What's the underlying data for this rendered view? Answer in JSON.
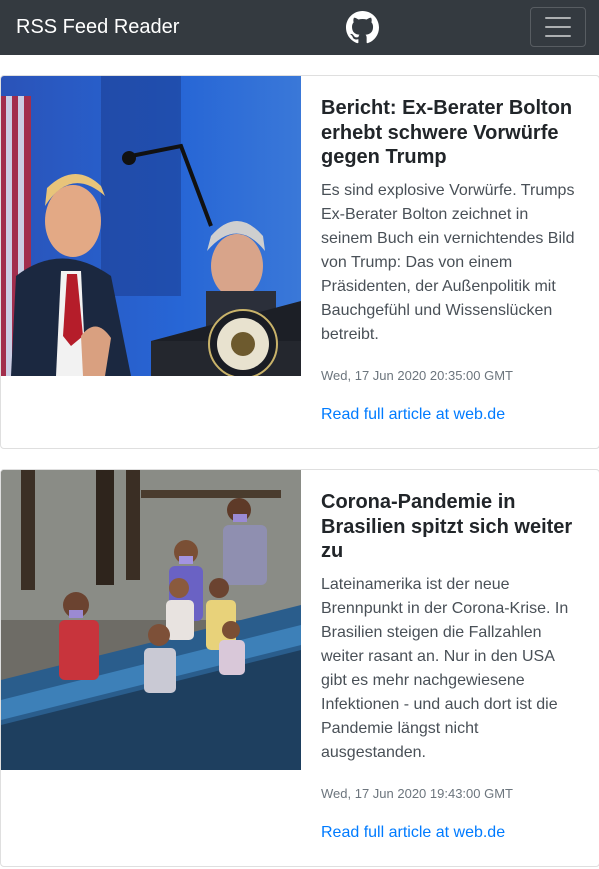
{
  "navbar": {
    "brand": "RSS Feed Reader",
    "github_icon": "github-icon",
    "menu_icon": "hamburger-icon"
  },
  "articles": [
    {
      "title": "Bericht: Ex-Berater Bolton erhebt schwere Vorwürfe gegen Trump",
      "description": "Es sind explosive Vorwürfe. Trumps Ex-Berater Bolton zeichnet in seinem Buch ein vernichtendes Bild von Trump: Das von einem Präsidenten, der Außenpolitik mit Bauchgefühl und Wissenslücken betreibt.",
      "date": "Wed, 17 Jun 2020 20:35:00 GMT",
      "link_text": "Read full article at web.de"
    },
    {
      "title": "Corona-Pandemie in Brasilien spitzt sich weiter zu",
      "description": "Lateinamerika ist der neue Brennpunkt in der Corona-Krise. In Brasilien steigen die Fallzahlen weiter rasant an. Nur in den USA gibt es mehr nachgewiesene Infektionen - und auch dort ist die Pandemie längst nicht ausgestanden.",
      "date": "Wed, 17 Jun 2020 19:43:00 GMT",
      "link_text": "Read full article at web.de"
    }
  ],
  "colors": {
    "navbar_bg": "#343a40",
    "link": "#007bff",
    "card_border": "#dfdfdf"
  }
}
